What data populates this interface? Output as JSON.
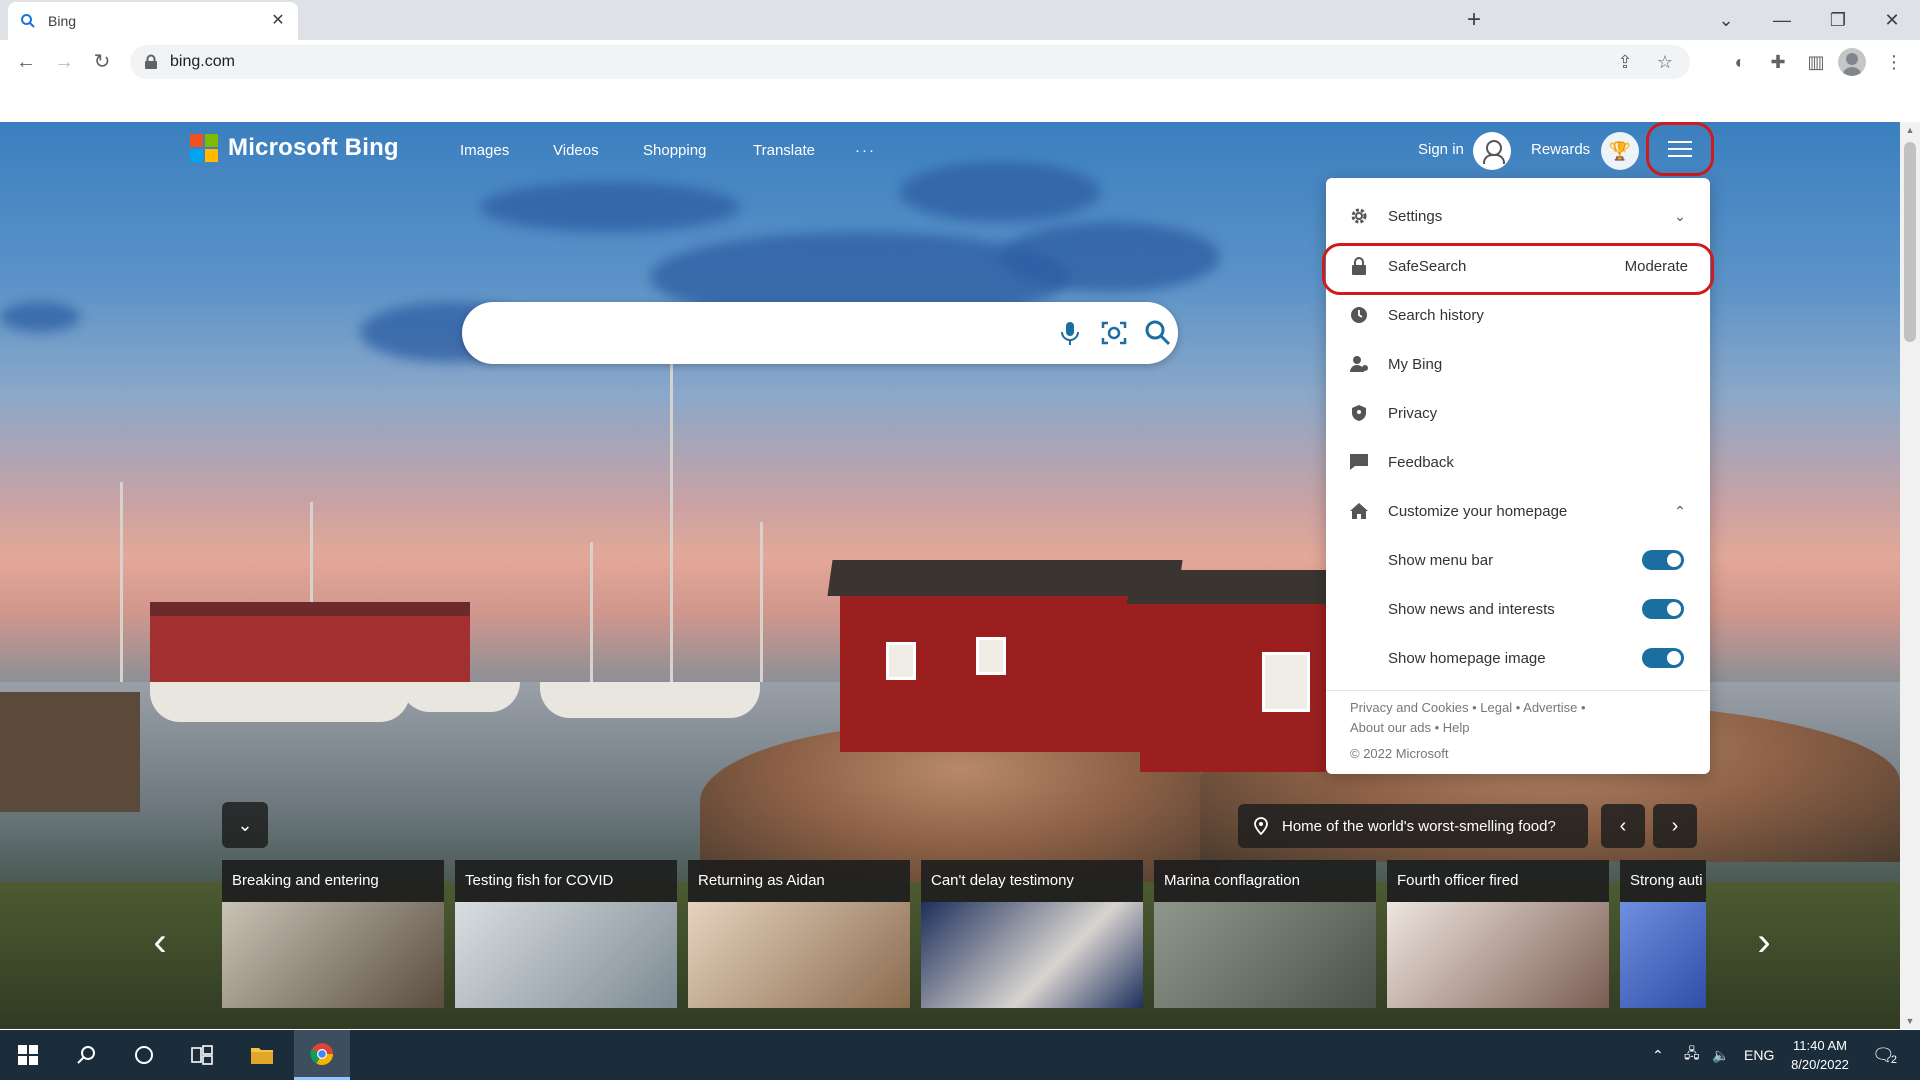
{
  "browser": {
    "tab_title": "Bing",
    "url": "bing.com"
  },
  "bing": {
    "brand": "Microsoft Bing",
    "nav": [
      "Images",
      "Videos",
      "Shopping",
      "Translate",
      "···"
    ],
    "sign_in": "Sign in",
    "rewards": "Rewards"
  },
  "search": {
    "placeholder": ""
  },
  "menu": {
    "items": [
      {
        "label": "Settings",
        "icon": "gear-icon"
      },
      {
        "label": "SafeSearch",
        "value": "Moderate",
        "icon": "lock-icon"
      },
      {
        "label": "Search history",
        "icon": "clock-icon"
      },
      {
        "label": "My Bing",
        "icon": "person-icon"
      },
      {
        "label": "Privacy",
        "icon": "shield-icon"
      },
      {
        "label": "Feedback",
        "icon": "feedback-icon"
      },
      {
        "label": "Customize your homepage",
        "icon": "home-icon"
      }
    ],
    "toggles": [
      {
        "label": "Show menu bar",
        "on": true
      },
      {
        "label": "Show news and interests",
        "on": true
      },
      {
        "label": "Show homepage image",
        "on": true
      }
    ],
    "footer": {
      "privacy": "Privacy and Cookies",
      "legal": "Legal",
      "advertise": "Advertise",
      "about_ads": "About our ads",
      "help": "Help",
      "copyright": "© 2022 Microsoft"
    }
  },
  "image_info": {
    "question": "Home of the world's worst-smelling food?"
  },
  "news": [
    {
      "title": "Breaking and entering",
      "color": "#8f8a80"
    },
    {
      "title": "Testing fish for COVID",
      "color": "#a9b4bd"
    },
    {
      "title": "Returning as Aidan",
      "color": "#b89e86"
    },
    {
      "title": "Can't delay testimony",
      "color": "#2c3f6e"
    },
    {
      "title": "Marina conflagration",
      "color": "#6f7668"
    },
    {
      "title": "Fourth officer fired",
      "color": "#c8b9b0"
    },
    {
      "title": "Strong auti",
      "color": "#5a78c8"
    }
  ],
  "taskbar": {
    "language": "ENG",
    "time": "11:40 AM",
    "date": "8/20/2022",
    "notifications": "2"
  },
  "colors": {
    "highlight_ring": "#d11a1a",
    "toggle_on": "#1a6ea0"
  }
}
